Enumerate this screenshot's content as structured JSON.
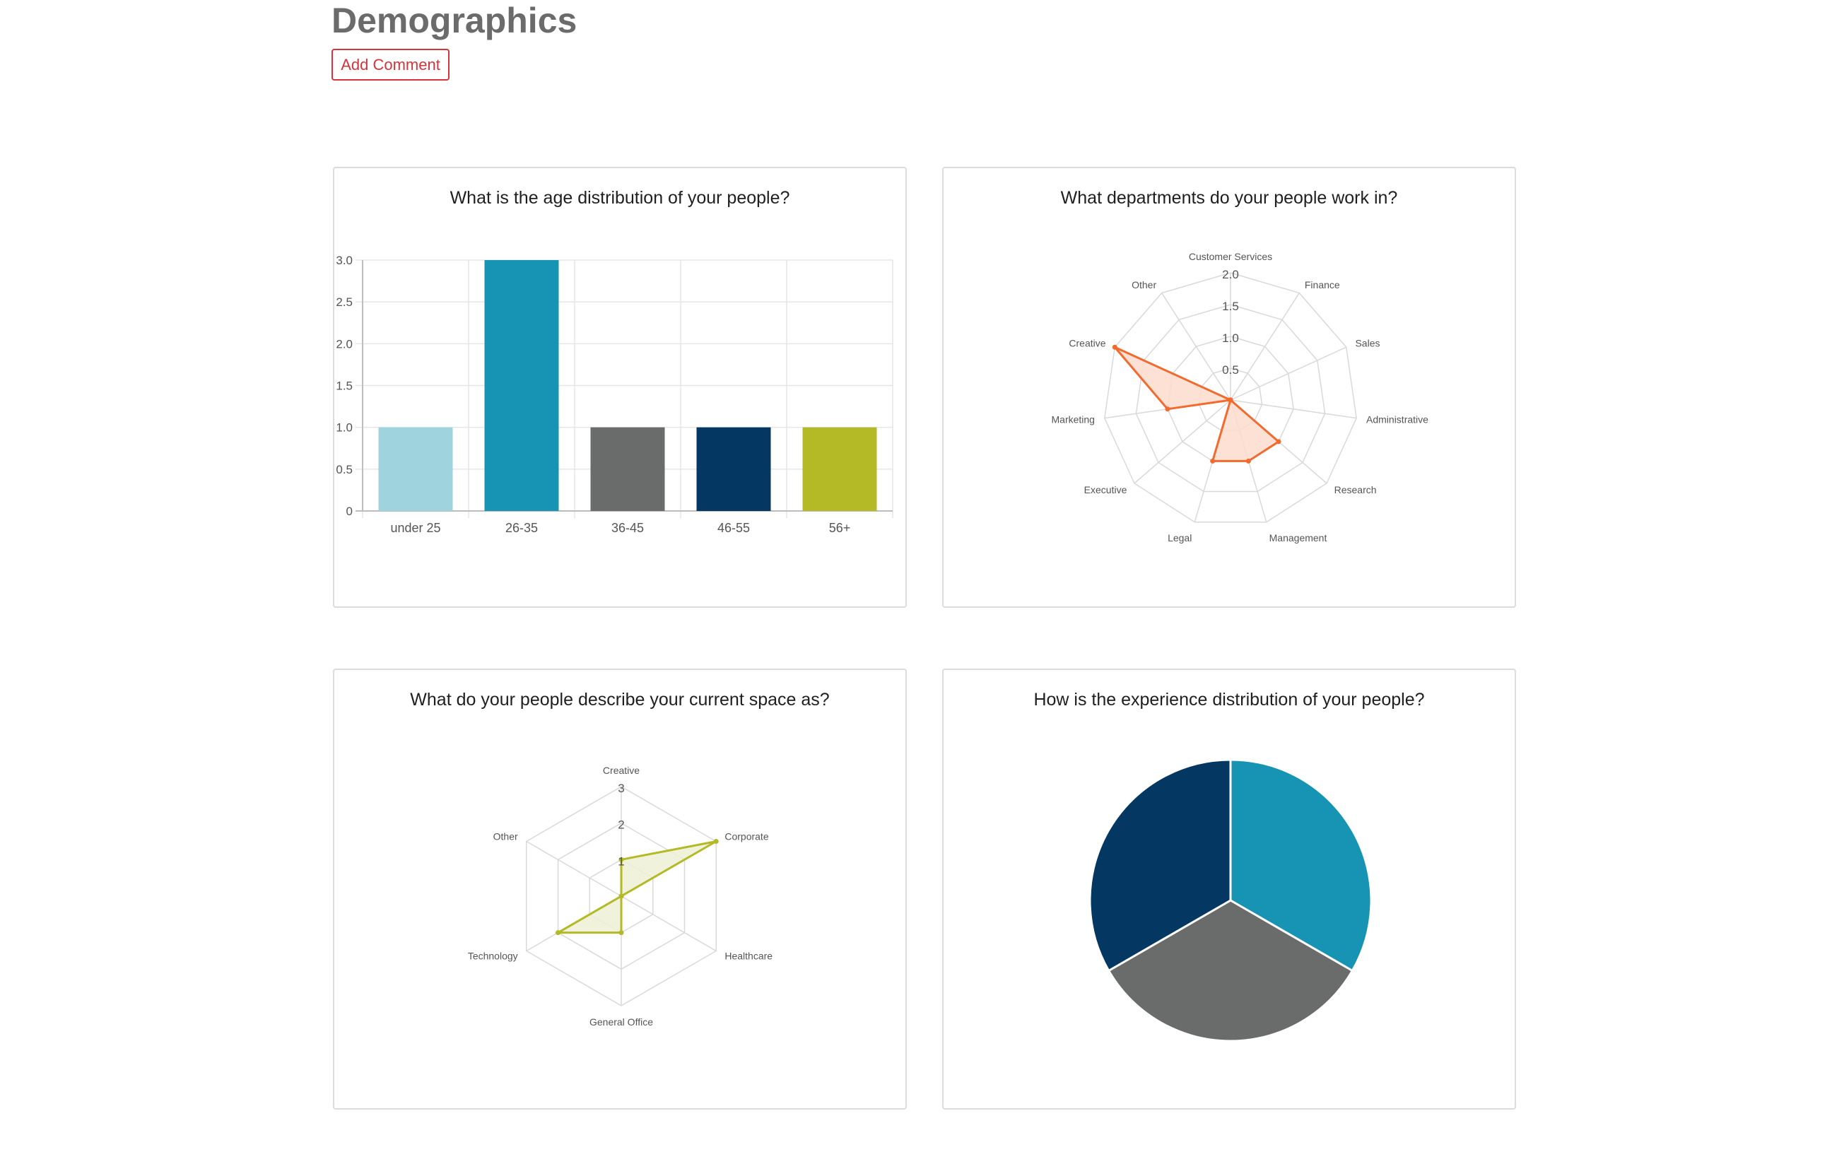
{
  "page": {
    "title": "Demographics",
    "add_comment_label": "Add Comment"
  },
  "colors": {
    "accent_red": "#d6343c",
    "light_blue": "#9fd3de",
    "teal": "#1793b4",
    "gray": "#6a6b6b",
    "navy": "#043862",
    "olive": "#b3ba25",
    "orange": "#f26a2d",
    "orange_fill": "#fbdccc",
    "olive_fill": "#eef0d6"
  },
  "chart_data": [
    {
      "id": "age",
      "type": "bar",
      "title": "What is the age distribution of your people?",
      "categories": [
        "under 25",
        "26-35",
        "36-45",
        "46-55",
        "56+"
      ],
      "values": [
        1,
        3,
        1,
        1,
        1
      ],
      "bar_colors": [
        "#9fd3de",
        "#1793b4",
        "#6a6b6b",
        "#043862",
        "#b3ba25"
      ],
      "ylim": [
        0,
        3
      ],
      "yticks": [
        "0",
        "0.5",
        "1.0",
        "1.5",
        "2.0",
        "2.5",
        "3.0"
      ],
      "grid": true
    },
    {
      "id": "departments",
      "type": "radar",
      "title": "What departments do your people work in?",
      "labels": [
        "Customer Services",
        "Finance",
        "Sales",
        "Administrative",
        "Research",
        "Management",
        "Legal",
        "Executive",
        "Marketing",
        "Creative",
        "Other"
      ],
      "values": [
        0,
        0,
        0,
        0,
        1,
        1,
        1,
        0,
        1,
        2,
        0
      ],
      "max": 2,
      "ticks": [
        "0.5",
        "1.0",
        "1.5",
        "2.0"
      ],
      "color": "#f26a2d",
      "fill": "#fbdccc"
    },
    {
      "id": "space",
      "type": "radar",
      "title": "What do your people describe your current space as?",
      "labels": [
        "Creative",
        "Corporate",
        "Healthcare",
        "General Office",
        "Technology",
        "Other"
      ],
      "values": [
        1,
        3,
        0,
        1,
        2,
        0
      ],
      "max": 3,
      "ticks": [
        "1",
        "2",
        "3"
      ],
      "color": "#b3ba25",
      "fill": "#eef0d6"
    },
    {
      "id": "experience",
      "type": "pie",
      "title": "How is the experience distribution of your people?",
      "values": [
        1,
        1,
        1
      ],
      "colors": [
        "#1793b4",
        "#6a6b6b",
        "#043862"
      ]
    }
  ]
}
